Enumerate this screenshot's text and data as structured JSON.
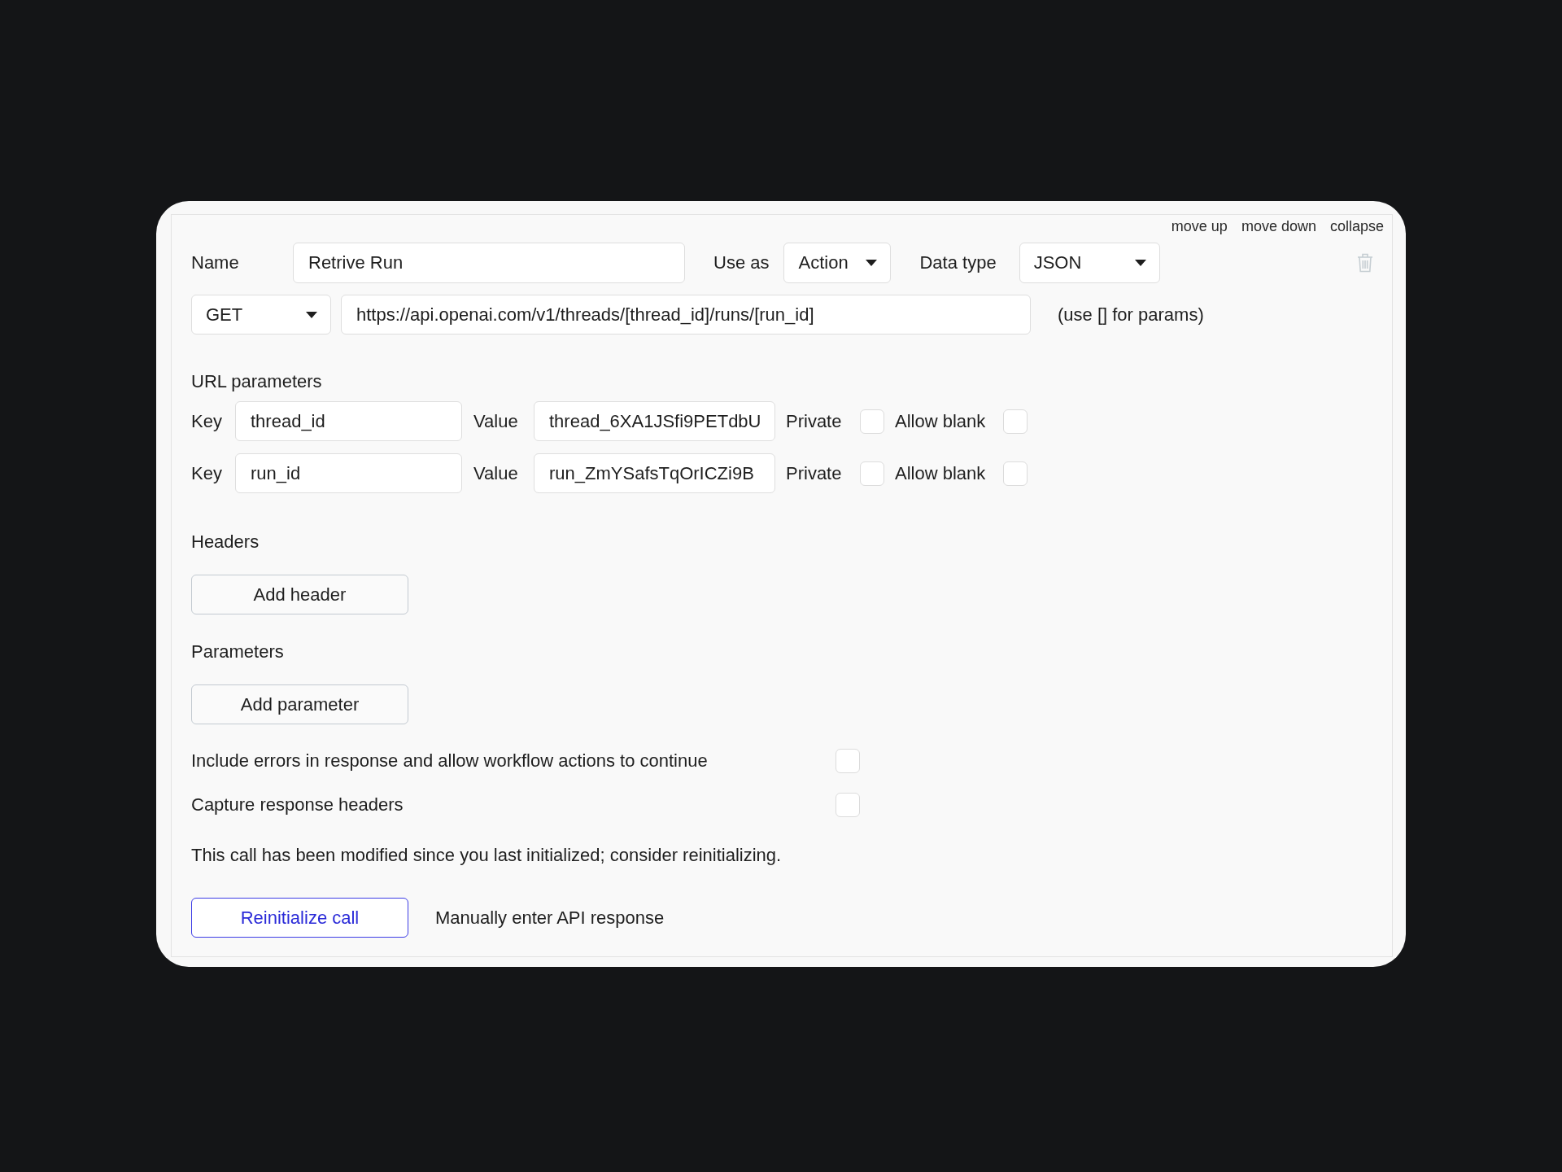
{
  "card_links": [
    "move up",
    "move down",
    "collapse"
  ],
  "call": {
    "name_label": "Name",
    "name_value": "Retrive Run",
    "use_as_label": "Use as",
    "use_as_value": "Action",
    "data_type_label": "Data type",
    "data_type_value": "JSON",
    "method": "GET",
    "url": "https://api.openai.com/v1/threads/[thread_id]/runs/[run_id]",
    "url_hint": "(use [] for params)"
  },
  "url_parameters": {
    "title": "URL parameters",
    "rows": [
      {
        "key_label": "Key",
        "key": "thread_id",
        "value_label": "Value",
        "value": "thread_6XA1JSfi9PETdbU",
        "private_label": "Private",
        "private": false,
        "allow_blank_label": "Allow blank",
        "allow_blank": false
      },
      {
        "key_label": "Key",
        "key": "run_id",
        "value_label": "Value",
        "value": "run_ZmYSafsTqOrICZi9B",
        "private_label": "Private",
        "private": false,
        "allow_blank_label": "Allow blank",
        "allow_blank": false
      }
    ]
  },
  "sections": [
    {
      "title": "Headers",
      "button": "Add header"
    },
    {
      "title": "Parameters",
      "button": "Add parameter"
    }
  ],
  "options": [
    {
      "label": "Include errors in response and allow workflow actions to continue",
      "checked": false
    },
    {
      "label": "Capture response headers",
      "checked": false
    }
  ],
  "notice": "This call has been modified since you last initialized; consider reinitializing.",
  "actions": {
    "primary": "Reinitialize call",
    "secondary": "Manually enter API response"
  }
}
